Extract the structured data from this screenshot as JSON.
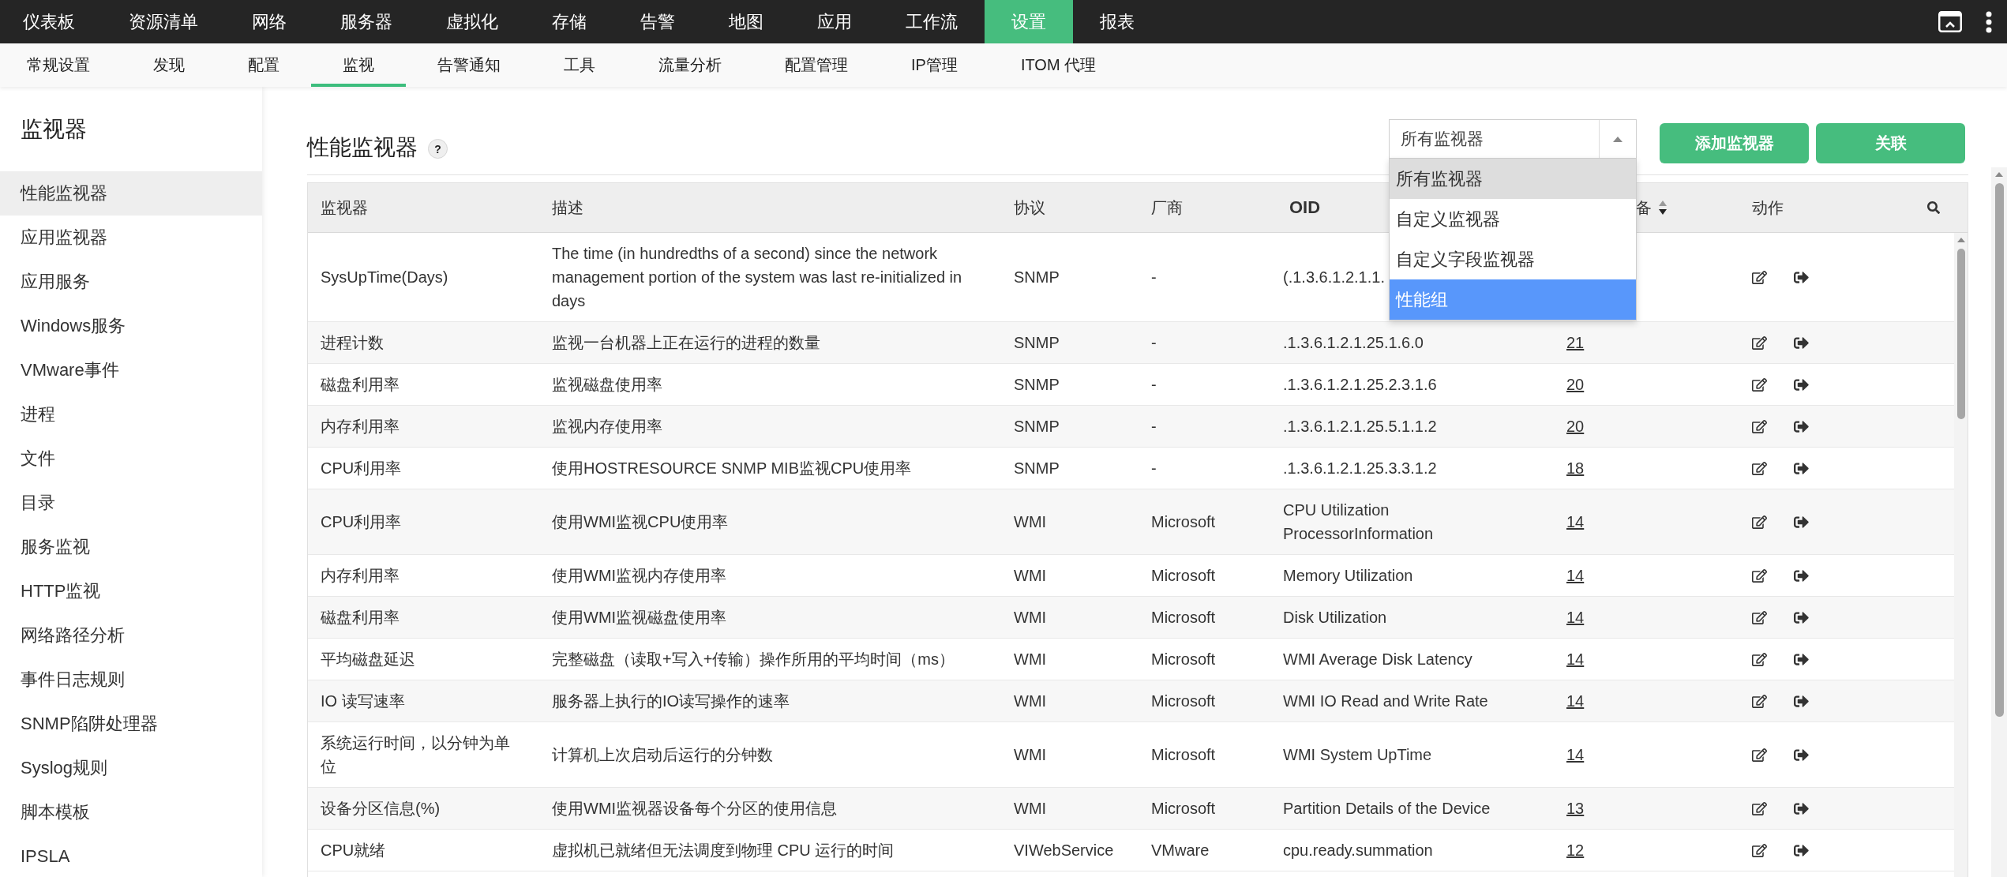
{
  "top_nav": {
    "items": [
      {
        "label": "仪表板",
        "selected": false
      },
      {
        "label": "资源清单",
        "selected": false
      },
      {
        "label": "网络",
        "selected": false
      },
      {
        "label": "服务器",
        "selected": false
      },
      {
        "label": "虚拟化",
        "selected": false
      },
      {
        "label": "存储",
        "selected": false
      },
      {
        "label": "告警",
        "selected": false
      },
      {
        "label": "地图",
        "selected": false
      },
      {
        "label": "应用",
        "selected": false
      },
      {
        "label": "工作流",
        "selected": false
      },
      {
        "label": "设置",
        "selected": true
      },
      {
        "label": "报表",
        "selected": false
      }
    ]
  },
  "sub_nav": {
    "items": [
      {
        "label": "常规设置",
        "selected": false
      },
      {
        "label": "发现",
        "selected": false
      },
      {
        "label": "配置",
        "selected": false
      },
      {
        "label": "监视",
        "selected": true
      },
      {
        "label": "告警通知",
        "selected": false
      },
      {
        "label": "工具",
        "selected": false
      },
      {
        "label": "流量分析",
        "selected": false
      },
      {
        "label": "配置管理",
        "selected": false
      },
      {
        "label": "IP管理",
        "selected": false
      },
      {
        "label": "ITOM 代理",
        "selected": false
      }
    ]
  },
  "sidebar": {
    "title": "监视器",
    "items": [
      {
        "label": "性能监视器",
        "selected": true
      },
      {
        "label": "应用监视器",
        "selected": false
      },
      {
        "label": "应用服务",
        "selected": false
      },
      {
        "label": "Windows服务",
        "selected": false
      },
      {
        "label": "VMware事件",
        "selected": false
      },
      {
        "label": "进程",
        "selected": false
      },
      {
        "label": "文件",
        "selected": false
      },
      {
        "label": "目录",
        "selected": false
      },
      {
        "label": "服务监视",
        "selected": false
      },
      {
        "label": "HTTP监视",
        "selected": false
      },
      {
        "label": "网络路径分析",
        "selected": false
      },
      {
        "label": "事件日志规则",
        "selected": false
      },
      {
        "label": "SNMP陷阱处理器",
        "selected": false
      },
      {
        "label": "Syslog规则",
        "selected": false
      },
      {
        "label": "脚本模板",
        "selected": false
      },
      {
        "label": "IPSLA",
        "selected": false
      }
    ]
  },
  "page": {
    "title": "性能监视器",
    "help": "?"
  },
  "filter": {
    "value": "所有监视器",
    "expanded": true,
    "options": [
      {
        "label": "所有监视器",
        "selected": true,
        "highlighted": false
      },
      {
        "label": "自定义监视器",
        "selected": false,
        "highlighted": false
      },
      {
        "label": "自定义字段监视器",
        "selected": false,
        "highlighted": false
      },
      {
        "label": "性能组",
        "selected": false,
        "highlighted": true
      }
    ]
  },
  "buttons": [
    {
      "label": "添加监视器"
    },
    {
      "label": "关联"
    }
  ],
  "table": {
    "columns": [
      {
        "label": "监视器",
        "bold": false,
        "sorted": false
      },
      {
        "label": "描述",
        "bold": false,
        "sorted": false
      },
      {
        "label": "协议",
        "bold": false,
        "sorted": false
      },
      {
        "label": "厂商",
        "bold": false,
        "sorted": false
      },
      {
        "label": "OID",
        "bold": true,
        "sorted": false
      },
      {
        "label": "备",
        "bold": false,
        "sorted": true
      },
      {
        "label": "动作",
        "bold": false,
        "sorted": false
      }
    ],
    "rows": [
      {
        "monitor": "SysUpTime(Days)",
        "description": "The time (in hundredths of a second) since the network management portion of the system was last re-initialized in days",
        "protocol": "SNMP",
        "vendor": "-",
        "oid": "(.1.3.6.1.2.1.1."
      },
      {
        "monitor": "进程计数",
        "description": "监视一台机器上正在运行的进程的数量",
        "protocol": "SNMP",
        "vendor": "-",
        "oid": ".1.3.6.1.2.1.25.1.6.0",
        "devices": "21"
      },
      {
        "monitor": "磁盘利用率",
        "description": "监视磁盘使用率",
        "protocol": "SNMP",
        "vendor": "-",
        "oid": ".1.3.6.1.2.1.25.2.3.1.6",
        "devices": "20"
      },
      {
        "monitor": "内存利用率",
        "description": "监视内存使用率",
        "protocol": "SNMP",
        "vendor": "-",
        "oid": ".1.3.6.1.2.1.25.5.1.1.2",
        "devices": "20"
      },
      {
        "monitor": "CPU利用率",
        "description": "使用HOSTRESOURCE SNMP MIB监视CPU使用率",
        "protocol": "SNMP",
        "vendor": "-",
        "oid": ".1.3.6.1.2.1.25.3.3.1.2",
        "devices": "18"
      },
      {
        "monitor": "CPU利用率",
        "description": "使用WMI监视CPU使用率",
        "protocol": "WMI",
        "vendor": "Microsoft",
        "oid": "CPU Utilization ProcessorInformation",
        "devices": "14"
      },
      {
        "monitor": "内存利用率",
        "description": "使用WMI监视内存使用率",
        "protocol": "WMI",
        "vendor": "Microsoft",
        "oid": "Memory Utilization",
        "devices": "14"
      },
      {
        "monitor": "磁盘利用率",
        "description": "使用WMI监视磁盘使用率",
        "protocol": "WMI",
        "vendor": "Microsoft",
        "oid": "Disk Utilization",
        "devices": "14"
      },
      {
        "monitor": "平均磁盘延迟",
        "description": "完整磁盘（读取+写入+传输）操作所用的平均时间（ms）",
        "protocol": "WMI",
        "vendor": "Microsoft",
        "oid": "WMI Average Disk Latency",
        "devices": "14"
      },
      {
        "monitor": "IO 读写速率",
        "description": "服务器上执行的IO读写操作的速率",
        "protocol": "WMI",
        "vendor": "Microsoft",
        "oid": "WMI IO Read and Write Rate",
        "devices": "14"
      },
      {
        "monitor": "系统运行时间，以分钟为单位",
        "description": "计算机上次启动后运行的分钟数",
        "protocol": "WMI",
        "vendor": "Microsoft",
        "oid": "WMI System UpTime",
        "devices": "14"
      },
      {
        "monitor": "设备分区信息(%)",
        "description": "使用WMI监视器设备每个分区的使用信息",
        "protocol": "WMI",
        "vendor": "Microsoft",
        "oid": "Partition Details of the Device",
        "devices": "13"
      },
      {
        "monitor": "CPU就绪",
        "description": "虚拟机已就绪但无法调度到物理 CPU 运行的时间",
        "protocol": "VIWebService",
        "vendor": "VMware",
        "oid": "cpu.ready.summation",
        "devices": "12"
      }
    ]
  }
}
